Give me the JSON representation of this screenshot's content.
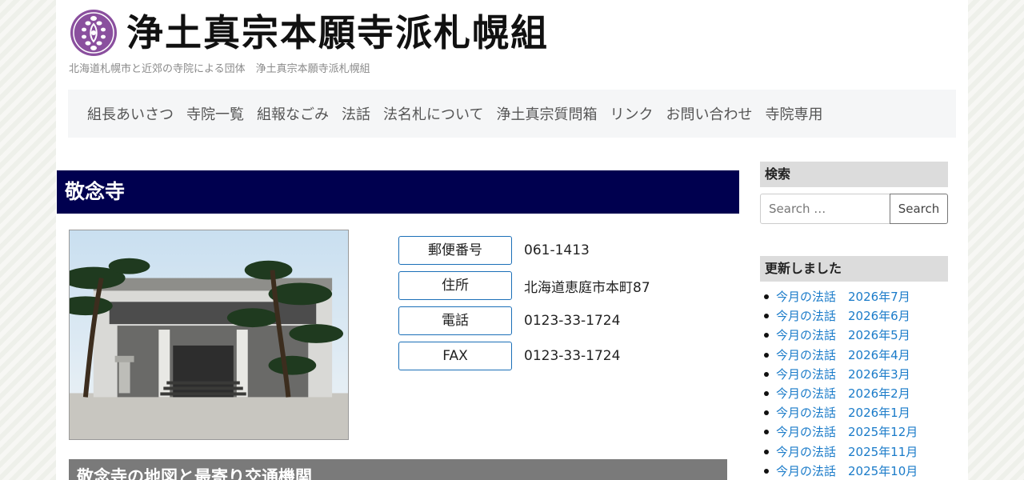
{
  "header": {
    "site_title": "浄土真宗本願寺派札幌組",
    "tagline": "北海道札幌市と近郊の寺院による団体　浄土真宗本願寺派札幌組",
    "logo_icon": "wisteria-crest-icon",
    "logo_color": "#8a4f9e"
  },
  "nav": {
    "items": [
      "組長あいさつ",
      "寺院一覧",
      "組報なごみ",
      "法話",
      "法名札について",
      "浄土真宗質問箱",
      "リンク",
      "お問い合わせ",
      "寺院専用"
    ]
  },
  "main": {
    "title": "敬念寺",
    "photo_icon": "temple-photo",
    "info": [
      {
        "label": "郵便番号",
        "value": "061-1413"
      },
      {
        "label": "住所",
        "value": "北海道恵庭市本町87"
      },
      {
        "label": "電話",
        "value": "0123-33-1724"
      },
      {
        "label": "FAX",
        "value": "0123-33-1724"
      }
    ],
    "map_heading": "敬念寺の地図と最寄り交通機関"
  },
  "sidebar": {
    "search_title": "検索",
    "search_placeholder": "Search …",
    "search_button": "Search",
    "updates_title": "更新しました",
    "updates": [
      "今月の法話　2026年7月",
      "今月の法話　2026年6月",
      "今月の法話　2026年5月",
      "今月の法話　2026年4月",
      "今月の法話　2026年3月",
      "今月の法話　2026年2月",
      "今月の法話　2026年1月",
      "今月の法話　2025年12月",
      "今月の法話　2025年11月",
      "今月の法話　2025年10月"
    ]
  },
  "colors": {
    "title_bar": "#00004f",
    "link": "#1a7bc9",
    "label_border": "#1b6fb8"
  }
}
